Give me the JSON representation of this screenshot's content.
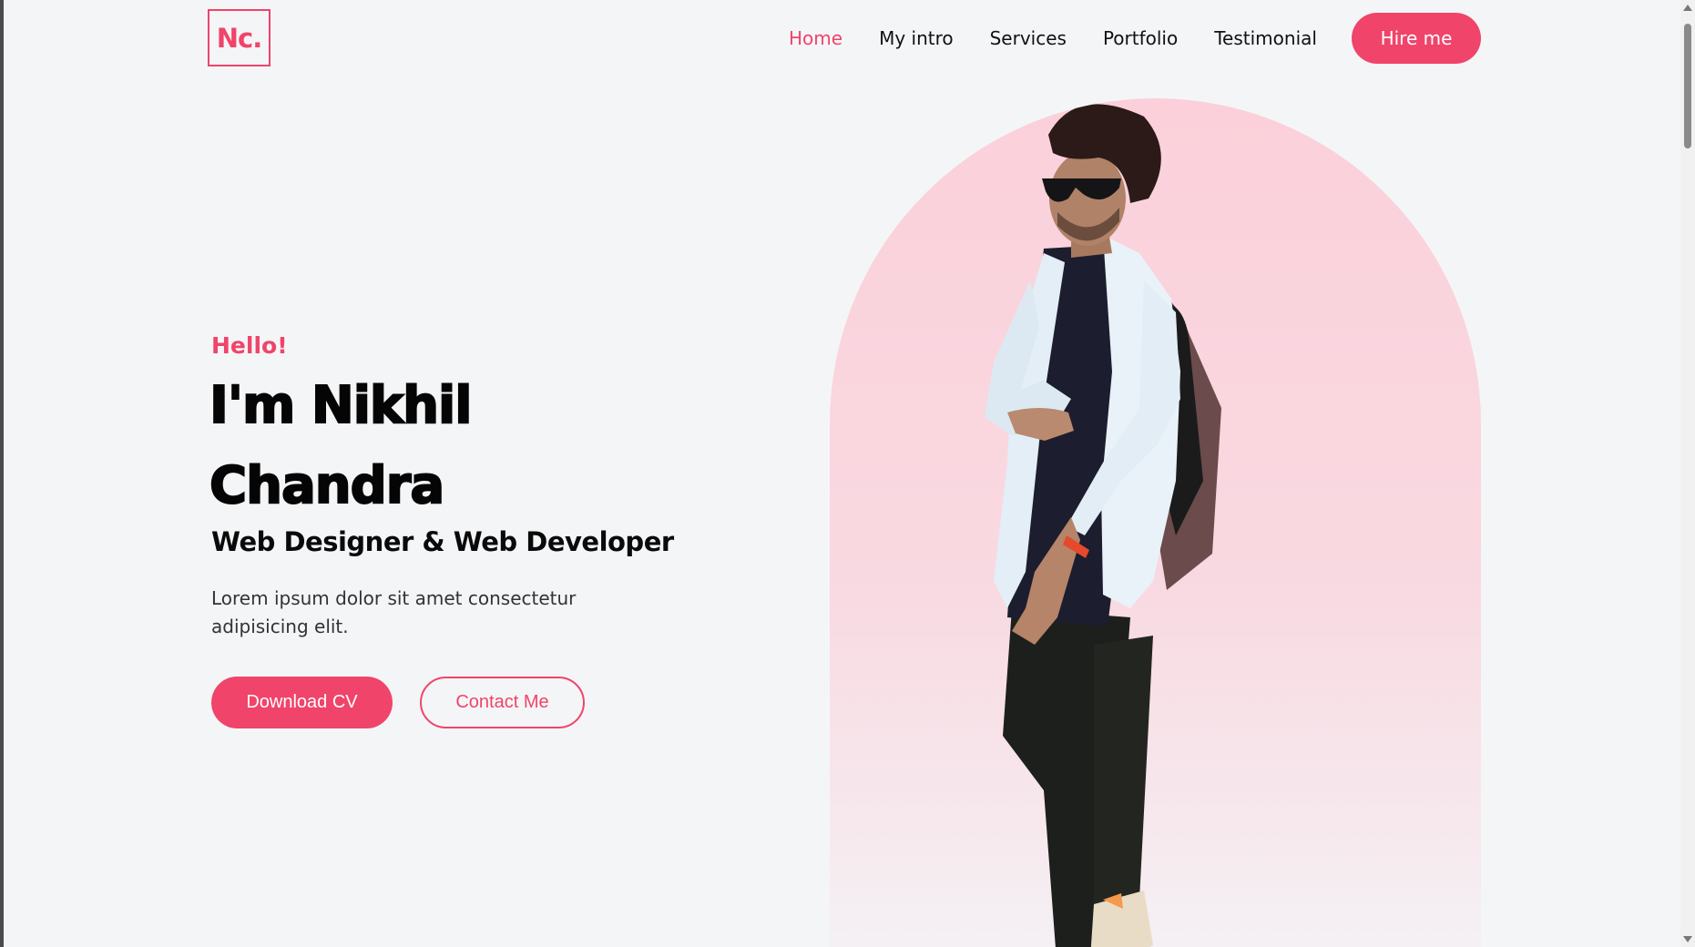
{
  "header": {
    "logo_text": "Nc.",
    "nav": [
      {
        "label": "Home",
        "active": true
      },
      {
        "label": "My intro",
        "active": false
      },
      {
        "label": "Services",
        "active": false
      },
      {
        "label": "Portfolio",
        "active": false
      },
      {
        "label": "Testimonial",
        "active": false
      }
    ],
    "hire_label": "Hire me"
  },
  "hero": {
    "greeting": "Hello!",
    "name_line1": "I'm Nikhil",
    "name_line2": "Chandra",
    "role": "Web Designer & Web Developer",
    "description": "Lorem ipsum dolor sit amet consectetur adipisicing elit.",
    "primary_button": "Download CV",
    "secondary_button": "Contact Me"
  },
  "colors": {
    "accent": "#f0446a",
    "background": "#f4f5f7",
    "arch_top": "#fbd0da",
    "text_dark": "#050505"
  }
}
